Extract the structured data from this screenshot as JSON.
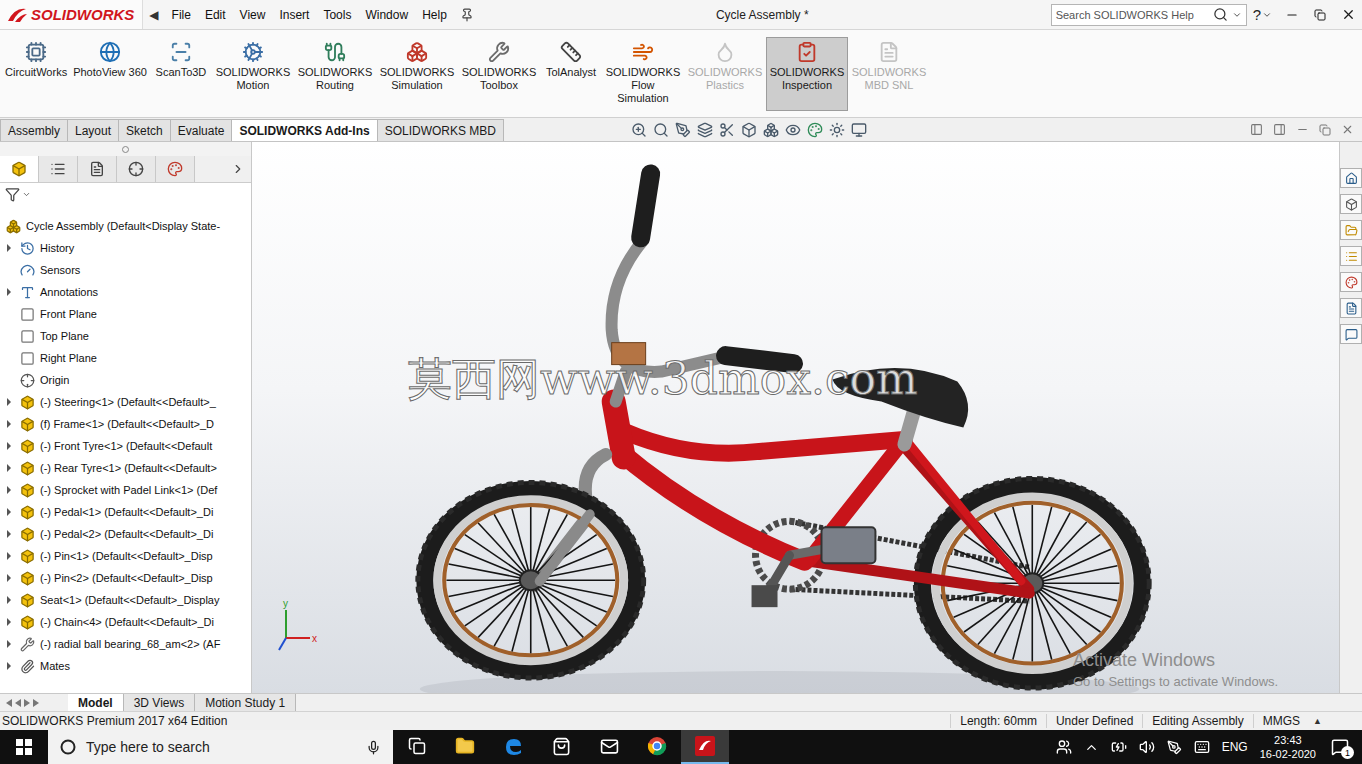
{
  "window": {
    "title": "Cycle Assembly *"
  },
  "logo": "SOLIDWORKS",
  "menu_arrow": "◀",
  "menu": [
    "File",
    "Edit",
    "View",
    "Insert",
    "Tools",
    "Window",
    "Help"
  ],
  "search": {
    "placeholder": "Search SOLIDWORKS Help"
  },
  "help": "?",
  "ribbon": [
    {
      "label": "CircuitWorks",
      "disabled": false,
      "selected": false
    },
    {
      "label": "PhotoView 360",
      "disabled": false,
      "selected": false
    },
    {
      "label": "ScanTo3D",
      "disabled": false,
      "selected": false
    },
    {
      "label": "SOLIDWORKS Motion",
      "disabled": false,
      "selected": false
    },
    {
      "label": "SOLIDWORKS Routing",
      "disabled": false,
      "selected": false
    },
    {
      "label": "SOLIDWORKS Simulation",
      "disabled": false,
      "selected": false
    },
    {
      "label": "SOLIDWORKS Toolbox",
      "disabled": false,
      "selected": false
    },
    {
      "label": "TolAnalyst",
      "disabled": false,
      "selected": false
    },
    {
      "label": "SOLIDWORKS Flow Simulation",
      "disabled": false,
      "selected": false
    },
    {
      "label": "SOLIDWORKS Plastics",
      "disabled": true,
      "selected": false
    },
    {
      "label": "SOLIDWORKS Inspection",
      "disabled": false,
      "selected": true
    },
    {
      "label": "SOLIDWORKS MBD SNL",
      "disabled": true,
      "selected": false
    }
  ],
  "tabs": [
    {
      "label": "Assembly",
      "selected": false
    },
    {
      "label": "Layout",
      "selected": false
    },
    {
      "label": "Sketch",
      "selected": false
    },
    {
      "label": "Evaluate",
      "selected": false
    },
    {
      "label": "SOLIDWORKS Add-Ins",
      "selected": true
    },
    {
      "label": "SOLIDWORKS MBD",
      "selected": false
    }
  ],
  "tree": {
    "root": "Cycle Assembly  (Default<Display State-",
    "items": [
      {
        "label": "History",
        "kind": "history",
        "expandable": true
      },
      {
        "label": "Sensors",
        "kind": "sensors",
        "expandable": false
      },
      {
        "label": "Annotations",
        "kind": "annotations",
        "expandable": true
      },
      {
        "label": "Front Plane",
        "kind": "plane",
        "expandable": false
      },
      {
        "label": "Top Plane",
        "kind": "plane",
        "expandable": false
      },
      {
        "label": "Right Plane",
        "kind": "plane",
        "expandable": false
      },
      {
        "label": "Origin",
        "kind": "origin",
        "expandable": false
      },
      {
        "label": "(-) Steering<1> (Default<<Default>_",
        "kind": "part",
        "expandable": true
      },
      {
        "label": "(f) Frame<1> (Default<<Default>_D",
        "kind": "part",
        "expandable": true
      },
      {
        "label": "(-) Front Tyre<1> (Default<<Default",
        "kind": "part",
        "expandable": true
      },
      {
        "label": "(-) Rear Tyre<1> (Default<<Default>",
        "kind": "part",
        "expandable": true
      },
      {
        "label": "(-) Sprocket with Padel Link<1> (Def",
        "kind": "part",
        "expandable": true
      },
      {
        "label": "(-) Pedal<1> (Default<<Default>_Di",
        "kind": "part",
        "expandable": true
      },
      {
        "label": "(-) Pedal<2> (Default<<Default>_Di",
        "kind": "part",
        "expandable": true
      },
      {
        "label": "(-) Pin<1> (Default<<Default>_Disp",
        "kind": "part",
        "expandable": true
      },
      {
        "label": "(-) Pin<2> (Default<<Default>_Disp",
        "kind": "part",
        "expandable": true
      },
      {
        "label": "Seat<1> (Default<<Default>_Display",
        "kind": "part",
        "expandable": true
      },
      {
        "label": "(-) Chain<4> (Default<<Default>_Di",
        "kind": "part",
        "expandable": true
      },
      {
        "label": "(-) radial ball bearing_68_am<2> (AF",
        "kind": "toolbox",
        "expandable": true
      },
      {
        "label": "Mates",
        "kind": "mates",
        "expandable": true
      }
    ]
  },
  "viewport": {
    "watermark": "莫西网www.3dmox.com",
    "activation": {
      "title": "Activate Windows",
      "subtitle": "Go to Settings to activate Windows."
    },
    "triad": {
      "x": "x",
      "y": "y"
    }
  },
  "bottom_tabs": [
    {
      "label": "Model",
      "selected": true
    },
    {
      "label": "3D Views",
      "selected": false
    },
    {
      "label": "Motion Study 1",
      "selected": false
    }
  ],
  "status_bar": {
    "edition": "SOLIDWORKS Premium 2017 x64 Edition",
    "fields": [
      "Length: 60mm",
      "Under Defined",
      "Editing Assembly",
      "MMGS"
    ],
    "arrow": "▲"
  },
  "taskbar": {
    "search_placeholder": "Type here to search",
    "language": "ENG",
    "time": "23:43",
    "date": "16-02-2020",
    "notifications": "1"
  }
}
